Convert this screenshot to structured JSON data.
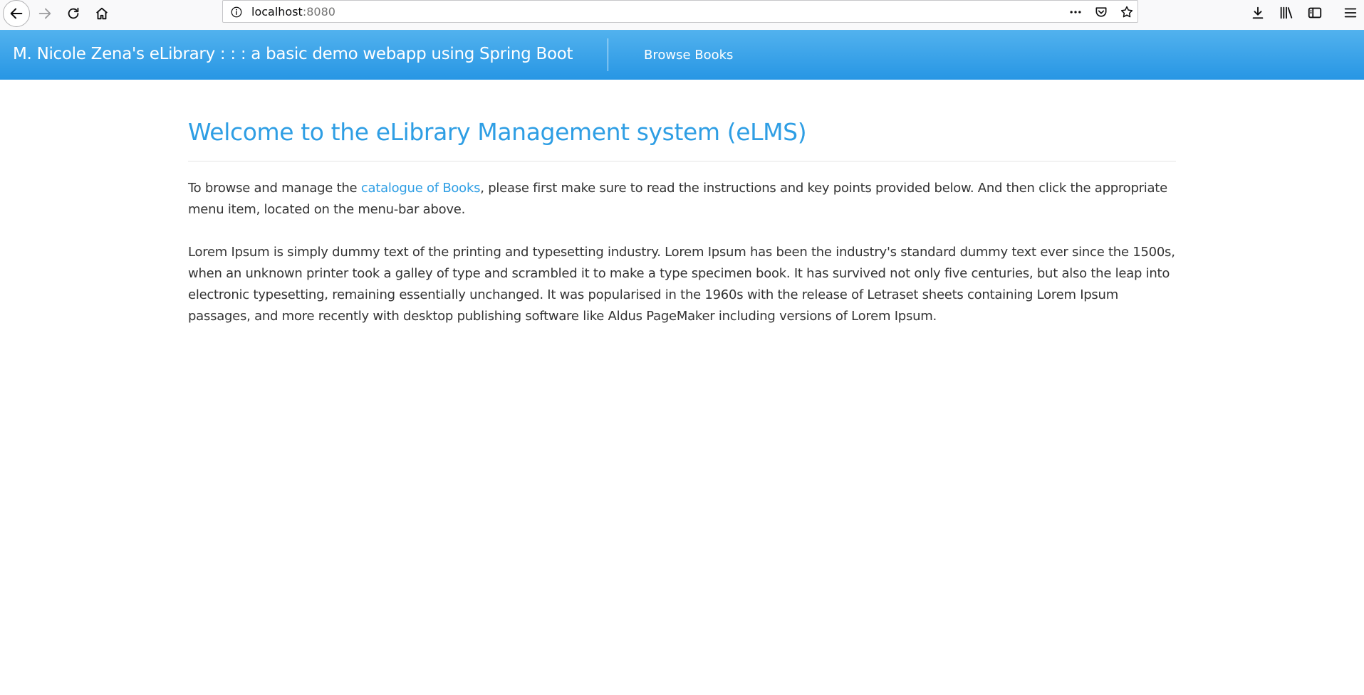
{
  "browser": {
    "url_host": "localhost",
    "url_port": ":8080"
  },
  "navbar": {
    "brand": "M. Nicole Zena's eLibrary : : : a basic demo webapp using Spring Boot",
    "browse_books": "Browse Books"
  },
  "main": {
    "title": "Welcome to the eLibrary Management system (eLMS)",
    "intro_before": "To browse and manage the ",
    "intro_link": "catalogue of Books",
    "intro_after": ", please first make sure to read the instructions and key points provided below. And then click the appropriate menu item, located on the menu-bar above.",
    "lorem": "Lorem Ipsum is simply dummy text of the printing and typesetting industry. Lorem Ipsum has been the industry's standard dummy text ever since the 1500s, when an unknown printer took a galley of type and scrambled it to make a type specimen book. It has survived not only five centuries, but also the leap into electronic typesetting, remaining essentially unchanged. It was popularised in the 1960s with the release of Letraset sheets containing Lorem Ipsum passages, and more recently with desktop publishing software like Aldus PageMaker including versions of Lorem Ipsum."
  },
  "colors": {
    "navbar_top": "#52b2ee",
    "navbar_bottom": "#2796e4",
    "accent": "#2e9ee4",
    "text": "#333333"
  }
}
